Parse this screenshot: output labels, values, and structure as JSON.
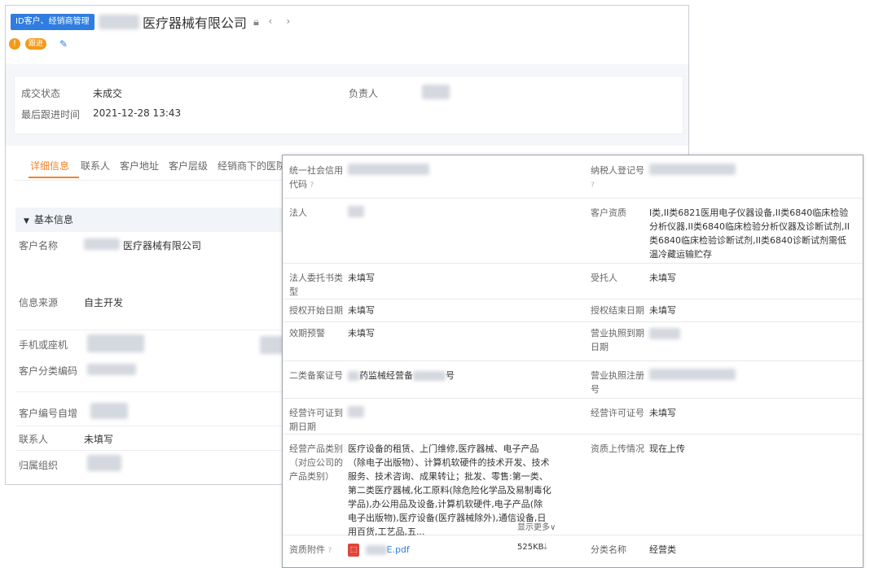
{
  "header": {
    "tag": "ID客户、经销商管理",
    "company_suffix": "医疗器械有限公司",
    "status_pill": "跟进",
    "status_num": "!"
  },
  "summary": {
    "deal_status_label": "成交状态",
    "deal_status_value": "未成交",
    "owner_label": "负责人",
    "last_follow_label": "最后跟进时间",
    "last_follow_value": "2021-12-28 13:43"
  },
  "tabs": [
    "详细信息",
    "联系人",
    "客户地址",
    "客户层级",
    "经销商下的医院"
  ],
  "basic": {
    "section_title": "基本信息",
    "fields": [
      {
        "label": "客户名称",
        "value": "医疗器械有限公司"
      },
      {
        "label": "信息来源",
        "value": "自主开发"
      },
      {
        "label": "手机或座机",
        "value": ""
      },
      {
        "label": "客户分类编码",
        "value": ""
      },
      {
        "label": "客户编号自增",
        "value": ""
      },
      {
        "label": "联系人",
        "value": "未填写"
      },
      {
        "label": "归属组织",
        "value": ""
      }
    ]
  },
  "details": {
    "credit_code_label": "统一社会信用代码",
    "taxpayer_label": "纳税人登记号",
    "legal_person_label": "法人",
    "qualification_label": "客户资质",
    "qualification_value": "I类,II类6821医用电子仪器设备,II类6840临床检验分析仪器,II类6840临床检验分析仪器及诊断试剂,II类6840临床检验诊断试剂,II类6840诊断试剂需低温冷藏运输贮存",
    "entrust_type_label": "法人委托书类型",
    "entrust_type_value": "未填写",
    "trustee_label": "受托人",
    "trustee_value": "未填写",
    "auth_start_label": "授权开始日期",
    "auth_start_value": "未填写",
    "auth_end_label": "授权结束日期",
    "auth_end_value": "未填写",
    "expiry_warn_label": "效期预警",
    "expiry_warn_value": "未填写",
    "license_expiry_label": "营业执照到期日期",
    "class2_record_label": "二类备案证号",
    "class2_record_value": "药监械经营备",
    "class2_record_suffix": "号",
    "license_reg_label": "营业执照注册号",
    "permit_expiry_label": "经营许可证到期日期",
    "permit_no_label": "经营许可证号",
    "permit_no_value": "未填写",
    "business_scope_label": "经营产品类别（对应公司的产品类别）",
    "business_scope_value": "医疗设备的租赁、上门维修,医疗器械、电子产品（除电子出版物）、计算机软硬件的技术开发、技术服务、技术咨询、成果转让；批发、零售:第一类、第二类医疗器械,化工原料(除危险化学品及易制毒化学品),办公用品及设备,计算机软硬件,电子产品(除电子出版物),医疗设备(医疗器械除外),通信设备,日用百货,工艺品,五...",
    "show_more": "显示更多",
    "upload_status_label": "资质上传情况",
    "upload_status_value": "现在上传",
    "attachment_label": "资质附件",
    "attachment_name": "E.pdf",
    "attachment_size": "525KB",
    "category_label": "分类名称",
    "category_value": "经营类"
  }
}
